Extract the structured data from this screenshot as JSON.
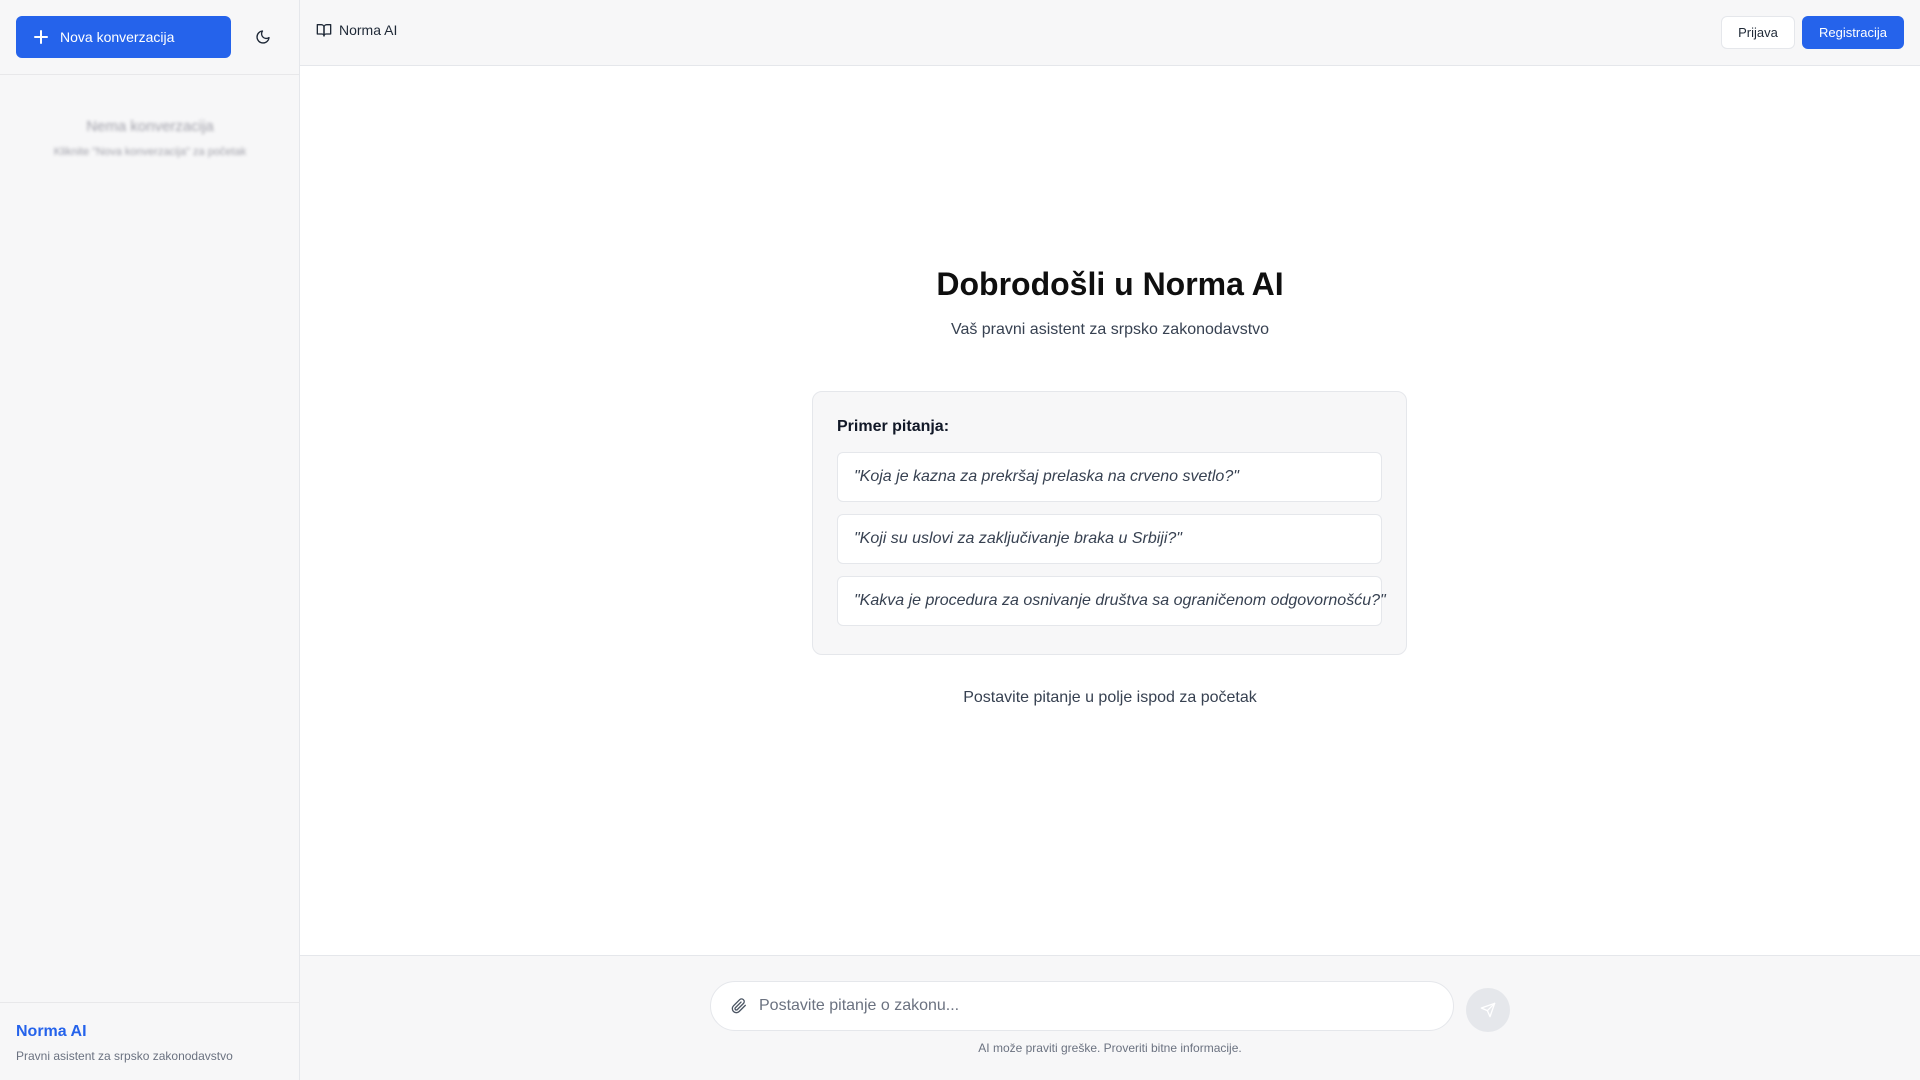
{
  "sidebar": {
    "new_conversation_label": "Nova konverzacija",
    "theme_toggle_icon": "moon-icon",
    "empty_title": "Nema konverzacija",
    "empty_subtitle": "Kliknite \"Nova konverzacija\" za početak",
    "footer_brand": "Norma AI",
    "footer_subtitle": "Pravni asistent za srpsko zakonodavstvo"
  },
  "header": {
    "brand_icon": "book-open-icon",
    "brand": "Norma AI",
    "login_label": "Prijava",
    "register_label": "Registracija"
  },
  "main": {
    "title": "Dobrodošli u Norma AI",
    "subtitle": "Vaš pravni asistent za srpsko zakonodavstvo",
    "examples_heading": "Primer pitanja:",
    "examples": [
      "\"Koja je kazna za prekršaj prelaska na crveno svetlo?\"",
      "\"Koji su uslovi za zaključivanje braka u Srbiji?\"",
      "\"Kakva je procedura za osnivanje društva sa ograničenom odgovornošću?\""
    ],
    "start_hint": "Postavite pitanje u polje ispod za početak"
  },
  "composer": {
    "attach_icon": "paperclip-icon",
    "placeholder": "Postavite pitanje o zakonu...",
    "value": "",
    "send_icon": "send-icon",
    "disclaimer": "AI može praviti greške. Proveriti bitne informacije."
  },
  "colors": {
    "accent": "#2563eb",
    "sidebar_bg": "#f7f7f8",
    "border": "#e5e7eb"
  }
}
